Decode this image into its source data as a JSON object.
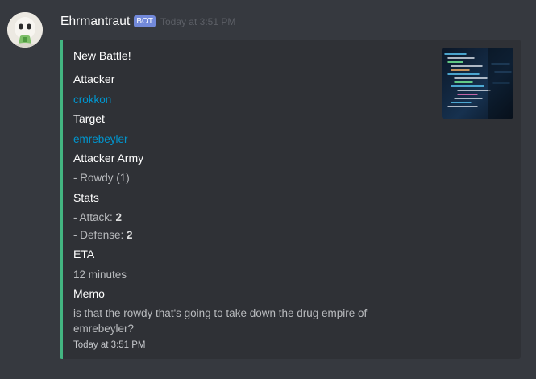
{
  "message": {
    "author": "Ehrmantraut",
    "bot_tag": "BOT",
    "timestamp": "Today at 3:51 PM"
  },
  "embed": {
    "accent_color": "#43b581",
    "title": "New Battle!",
    "fields": {
      "attacker": {
        "name": "Attacker",
        "value": "crokkon"
      },
      "target": {
        "name": "Target",
        "value": "emrebeyler"
      },
      "army": {
        "name": "Attacker Army",
        "value": "- Rowdy (1)"
      },
      "stats": {
        "name": "Stats",
        "attack_label": "- Attack: ",
        "attack_value": "2",
        "defense_label": "- Defense: ",
        "defense_value": "2"
      },
      "eta": {
        "name": "ETA",
        "value": "12 minutes"
      },
      "memo": {
        "name": "Memo",
        "value": "is that the rowdy that's going to take down the drug empire of emrebeyler?"
      }
    },
    "footer": "Today at 3:51 PM",
    "thumbnail_icon": "code-screen-thumbnail"
  },
  "colors": {
    "background": "#36393f",
    "embed_background": "#2f3136",
    "link": "#0096cf",
    "bot_tag": "#7289da"
  }
}
